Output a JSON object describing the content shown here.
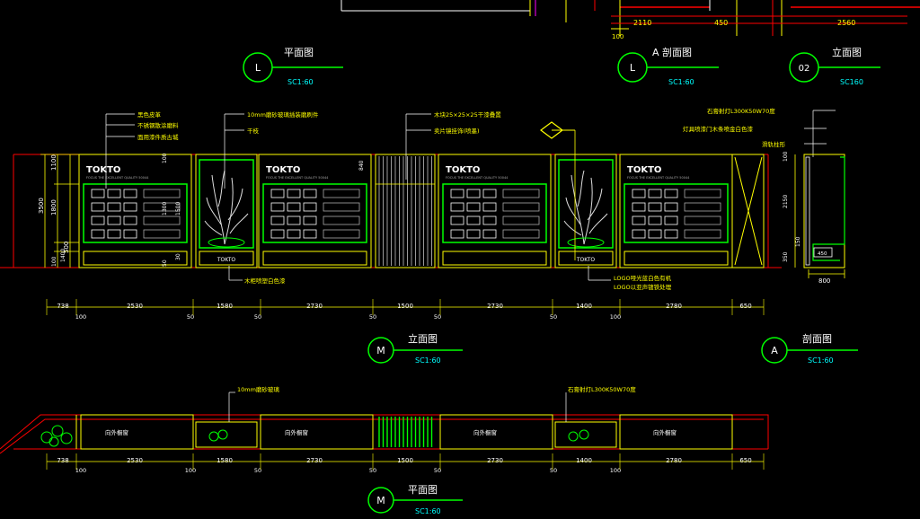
{
  "titles": {
    "plan_top": "平面图",
    "section_a_top": "A 剖面图",
    "elev_top": "立面图",
    "elev_main": "立面图",
    "section_right": "剖面图",
    "plan_bottom": "平面图"
  },
  "badges": {
    "plan_top": "L",
    "section_a_top": "L",
    "elev_top": "02",
    "elev_main": "M",
    "section_right": "A",
    "plan_bottom": "M"
  },
  "scales": {
    "plan_top": "SC1:60",
    "section_a_top": "SC1:60",
    "elev_top": "SC160",
    "elev_main": "SC1:60",
    "section_right": "SC1:60",
    "plan_bottom": "SC1:60"
  },
  "top_dims": [
    "2110",
    "450",
    "2560",
    "100"
  ],
  "annotations": {
    "a1": "黑色皮革",
    "a2": "不锈钢散涂磨料",
    "a3": "面用漆件质古城",
    "a4": "10mm磨砂玻璃插装磨刷件",
    "a5": "干枝",
    "a6": "木块25×25×25干漆叠置",
    "a7": "卖片镜挂饰(喷墨)",
    "a8": "石膏射灯L300K50W70度",
    "a9": "灯具喷漆门木条喷金白色漆",
    "a10": "滑轨柱形",
    "a11": "木柜喷塑白色漆",
    "a12": "LOGO哑光蓝白色有机",
    "a13": "LOGO以亚声镀铁处理",
    "a14": "10mm磨砂玻璃",
    "a15": "石膏射灯L300K50W70度"
  },
  "brand": "TOKTO",
  "brand_sub": "FOCUS THE EXCELLENT QUALITY 50044",
  "window_label": "向外橱窗",
  "elev_dims_main": [
    "738",
    "2530",
    "1580",
    "2730",
    "1500",
    "2730",
    "1400",
    "2780",
    "650"
  ],
  "elev_dims_sub": [
    "100",
    "50",
    "50",
    "50",
    "50",
    "50",
    "100"
  ],
  "plan_dims_main": [
    "738",
    "2530",
    "1580",
    "2730",
    "1500",
    "2730",
    "1400",
    "2780",
    "650"
  ],
  "plan_dims_sub": [
    "100",
    "100",
    "50",
    "50",
    "50",
    "50",
    "100"
  ],
  "left_height_dims": [
    "3500",
    "1800",
    "1100",
    "500",
    "100",
    "500",
    "1400"
  ],
  "small_dims": [
    "100",
    "1300",
    "1500",
    "50",
    "30",
    "840",
    "100",
    "50",
    "350"
  ],
  "section_dims": [
    "100",
    "2150",
    "150",
    "350",
    "800",
    "450"
  ],
  "colors": {
    "background": "#000000",
    "cad_red": "#ff0000",
    "cad_yellow": "#ffff00",
    "cad_green": "#00ff00",
    "cad_cyan": "#00ffff",
    "cad_white": "#ffffff",
    "cad_magenta": "#ff00ff"
  }
}
